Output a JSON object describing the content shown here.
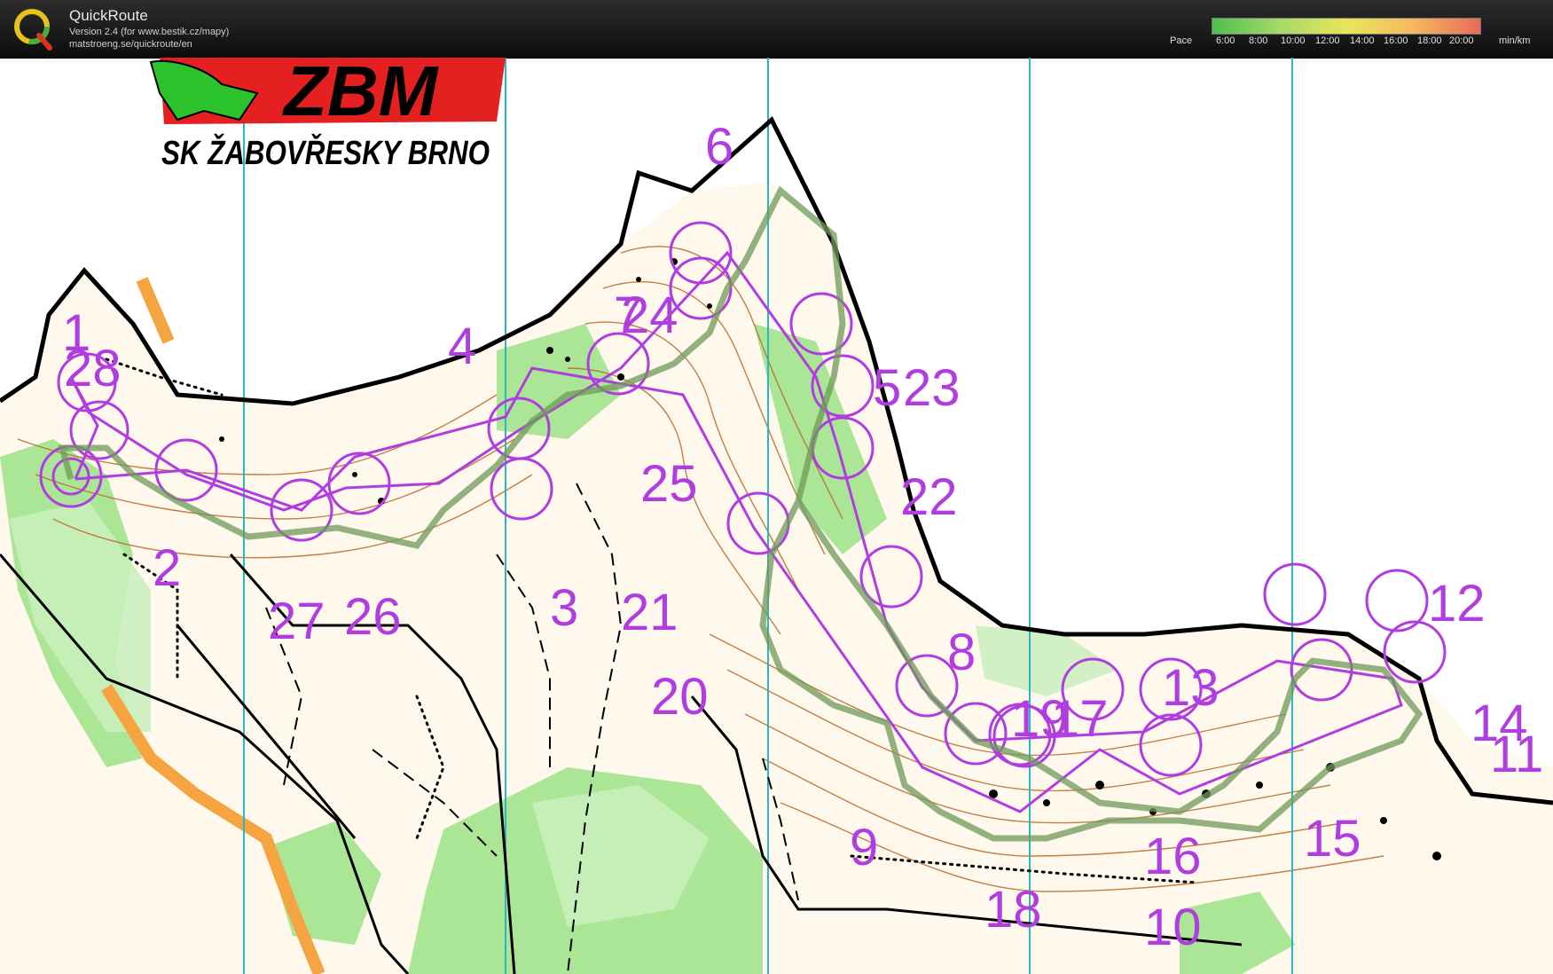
{
  "app": {
    "title": "QuickRoute",
    "version_line": "Version 2.4  (for www.bestik.cz/mapy)",
    "url_line": "matstroeng.se/quickroute/en",
    "logo_letter": "Q"
  },
  "pace_legend": {
    "label": "Pace",
    "ticks": [
      "6:00",
      "8:00",
      "10:00",
      "12:00",
      "14:00",
      "16:00",
      "18:00",
      "20:00"
    ],
    "unit": "min/km",
    "colors": [
      "#4fbf4f",
      "#a6d96a",
      "#e8e65a",
      "#f4b860",
      "#e86a5a"
    ]
  },
  "club_logo": {
    "letters": "ZBM",
    "name": "SK ŽABOVŘESKY BRNO"
  },
  "colors": {
    "course": "#b03de0",
    "contour": "#b86a2a",
    "meridian": "#27b8c4",
    "vegetation": "#7ad66a",
    "route": "#6f9a5a"
  },
  "controls": [
    "1",
    "28",
    "2",
    "27",
    "26",
    "3",
    "4",
    "24",
    "23",
    "6",
    "7",
    "5",
    "22",
    "25",
    "21",
    "20",
    "8",
    "19",
    "17",
    "13",
    "12",
    "14",
    "11",
    "15",
    "16",
    "10",
    "18",
    "9"
  ]
}
